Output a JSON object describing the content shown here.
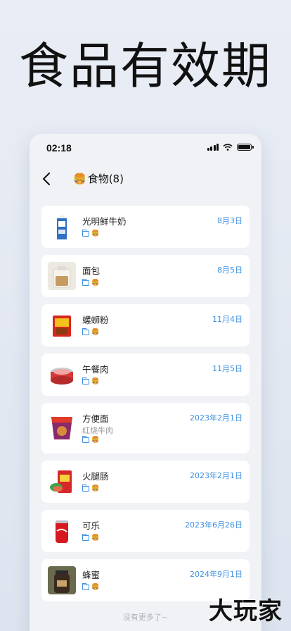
{
  "hero": {
    "title": "食品有效期"
  },
  "status": {
    "time": "02:18"
  },
  "nav": {
    "title": "食物(8)",
    "title_emoji": "🍔"
  },
  "items": [
    {
      "name": "光明鲜牛奶",
      "date": "8月3日",
      "sub": "",
      "thumb": "milk"
    },
    {
      "name": "面包",
      "date": "8月5日",
      "sub": "",
      "thumb": "bread"
    },
    {
      "name": "螺蛳粉",
      "date": "11月4日",
      "sub": "",
      "thumb": "noodle-pack"
    },
    {
      "name": "午餐肉",
      "date": "11月5日",
      "sub": "",
      "thumb": "luncheon-meat"
    },
    {
      "name": "方便面",
      "date": "2023年2月1日",
      "sub": "红烧牛肉",
      "thumb": "instant-noodle"
    },
    {
      "name": "火腿肠",
      "date": "2023年2月1日",
      "sub": "",
      "thumb": "sausage"
    },
    {
      "name": "可乐",
      "date": "2023年6月26日",
      "sub": "",
      "thumb": "cola"
    },
    {
      "name": "蜂蜜",
      "date": "2024年9月1日",
      "sub": "",
      "thumb": "honey"
    }
  ],
  "footer": {
    "no_more": "没有更多了~"
  },
  "watermark": "大玩家",
  "colors": {
    "accent": "#3d8fe0",
    "background": "#f1f2f6"
  }
}
